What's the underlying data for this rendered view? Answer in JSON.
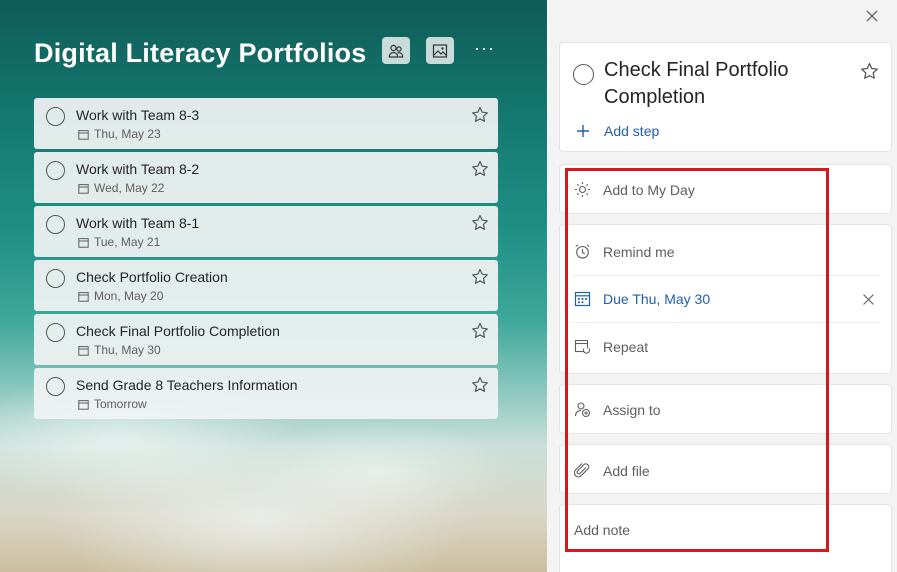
{
  "list": {
    "title": "Digital Literacy Portfolios",
    "more_label": "···",
    "tasks": [
      {
        "title": "Work with Team 8-3",
        "due": "Thu, May 23"
      },
      {
        "title": "Work with Team 8-2",
        "due": "Wed, May 22"
      },
      {
        "title": "Work with Team 8-1",
        "due": "Tue, May 21"
      },
      {
        "title": "Check Portfolio Creation",
        "due": "Mon, May 20"
      },
      {
        "title": "Check Final Portfolio Completion",
        "due": "Thu, May 30"
      },
      {
        "title": "Send Grade 8 Teachers Information",
        "due": "Tomorrow"
      }
    ]
  },
  "detail": {
    "title": "Check Final Portfolio Completion",
    "add_step": "Add step",
    "add_to_my_day": "Add to My Day",
    "remind_me": "Remind me",
    "due": "Due Thu, May 30",
    "repeat": "Repeat",
    "assign_to": "Assign to",
    "add_file": "Add file",
    "add_note": "Add note"
  },
  "colors": {
    "accent": "#1f5fb0",
    "highlight": "#d9151e"
  }
}
